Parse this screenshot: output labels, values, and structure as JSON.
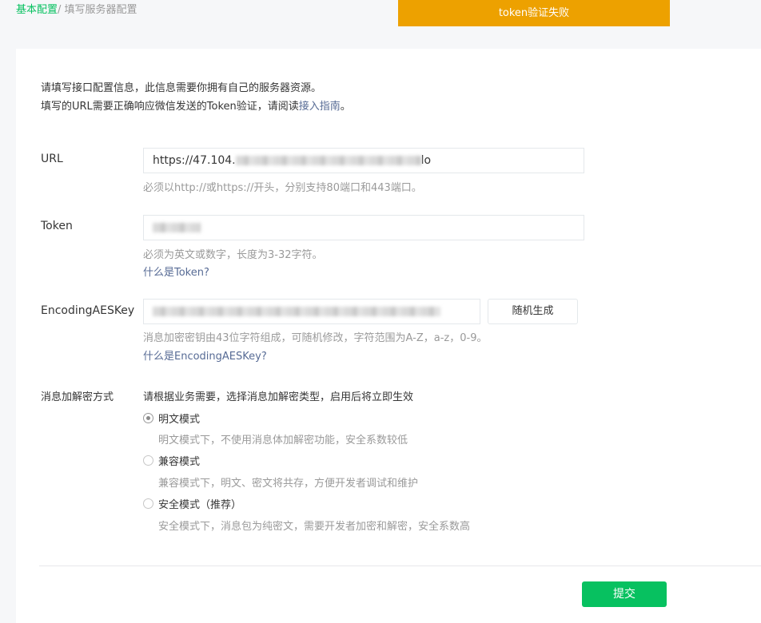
{
  "breadcrumb": {
    "root": "基本配置",
    "separator": "/ ",
    "current": "填写服务器配置"
  },
  "toast": {
    "message": "token验证失败",
    "color": "#eda100"
  },
  "intro": {
    "line1": "请填写接口配置信息，此信息需要你拥有自己的服务器资源。",
    "line2_prefix": "填写的URL需要正确响应微信发送的Token验证，请阅读",
    "line2_link": "接入指南",
    "line2_suffix": "。"
  },
  "form": {
    "url": {
      "label": "URL",
      "value_prefix": "https://47.104.",
      "value_suffix": "lo",
      "hint": "必须以http://或https://开头，分别支持80端口和443端口。"
    },
    "token": {
      "label": "Token",
      "hint": "必须为英文或数字，长度为3-32字符。",
      "help_link": "什么是Token?"
    },
    "aes_key": {
      "label": "EncodingAESKey",
      "random_button": "随机生成",
      "hint": "消息加密密钥由43位字符组成，可随机修改，字符范围为A-Z，a-z，0-9。",
      "help_link": "什么是EncodingAESKey?"
    },
    "encryption": {
      "label": "消息加解密方式",
      "intro": "请根据业务需要，选择消息加解密类型，启用后将立即生效",
      "options": [
        {
          "label": "明文模式",
          "desc": "明文模式下，不使用消息体加解密功能，安全系数较低",
          "checked": true
        },
        {
          "label": "兼容模式",
          "desc": "兼容模式下，明文、密文将共存，方便开发者调试和维护",
          "checked": false
        },
        {
          "label": "安全模式（推荐）",
          "desc": "安全模式下，消息包为纯密文，需要开发者加密和解密，安全系数高",
          "checked": false
        }
      ]
    },
    "submit_label": "提交",
    "accent_color": "#07c160"
  }
}
